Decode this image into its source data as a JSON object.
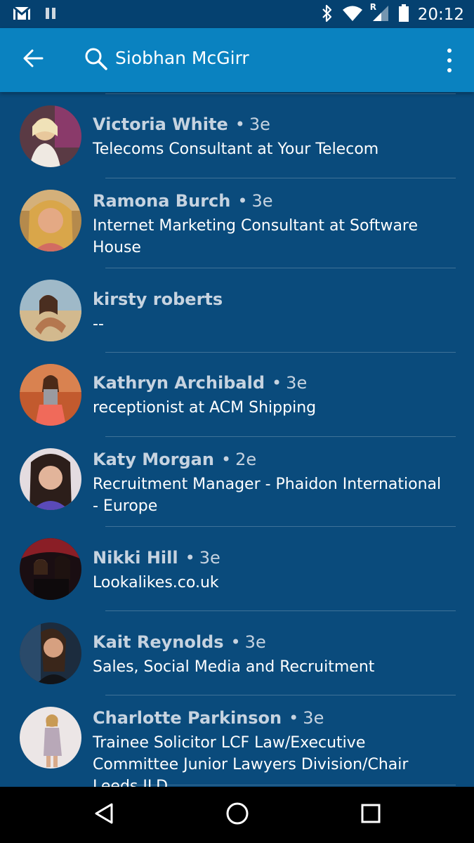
{
  "status_bar": {
    "time": "20:12",
    "network_indicator": "R",
    "icons": [
      "gmail-icon",
      "pause-icon",
      "bluetooth-icon",
      "wifi-icon",
      "signal-icon",
      "battery-icon"
    ]
  },
  "app_bar": {
    "search_query": "Siobhan McGirr",
    "icons": [
      "back-arrow-icon",
      "search-icon",
      "overflow-menu-icon"
    ]
  },
  "results": [
    {
      "name": "Victoria White",
      "separator": "•",
      "degree": "3e",
      "headline": "Telecoms Consultant at Your Telecom"
    },
    {
      "name": "Ramona Burch",
      "separator": "•",
      "degree": "3e",
      "headline": "Internet Marketing Consultant at Software House"
    },
    {
      "name": "kirsty roberts",
      "separator": "",
      "degree": "",
      "headline": "--"
    },
    {
      "name": "Kathryn Archibald",
      "separator": "•",
      "degree": "3e",
      "headline": "receptionist at ACM Shipping"
    },
    {
      "name": "Katy Morgan",
      "separator": "•",
      "degree": "2e",
      "headline": "Recruitment Manager - Phaidon International - Europe"
    },
    {
      "name": "Nikki Hill",
      "separator": "•",
      "degree": "3e",
      "headline": "Lookalikes.co.uk"
    },
    {
      "name": "Kait Reynolds",
      "separator": "•",
      "degree": "3e",
      "headline": "Sales, Social Media and Recruitment"
    },
    {
      "name": "Charlotte Parkinson",
      "separator": "•",
      "degree": "3e",
      "headline": "Trainee Solicitor LCF Law/Executive Committee Junior Lawyers Division/Chair Leeds JLD"
    }
  ],
  "nav_bar": {
    "icons": [
      "back-triangle-icon",
      "home-circle-icon",
      "recents-square-icon"
    ]
  },
  "colors": {
    "background": "#0a4b7c",
    "app_bar": "#0a82c0",
    "status_bar": "#054170",
    "name_text": "#c6d3e0",
    "headline_text": "#ffffff"
  }
}
